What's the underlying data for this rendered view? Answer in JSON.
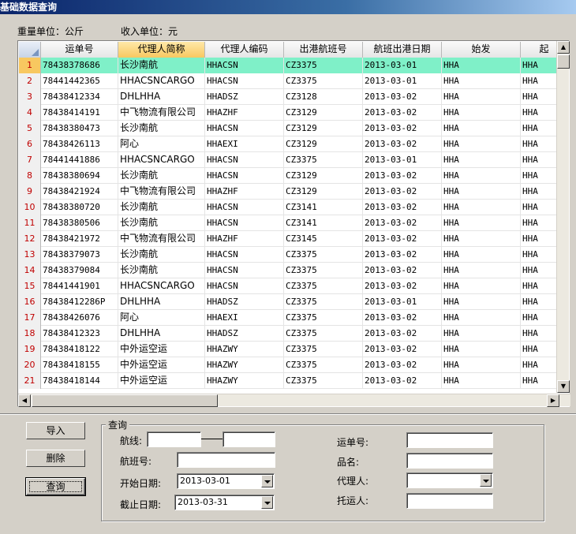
{
  "window": {
    "title": "基础数据查询"
  },
  "units": {
    "weight": "重量单位：公斤",
    "income": "收入单位：元"
  },
  "grid": {
    "columns": [
      "运单号",
      "代理人简称",
      "代理人编码",
      "出港航班号",
      "航班出港日期",
      "始发",
      "起"
    ],
    "rows": [
      {
        "n": "1",
        "awb": "78438378686",
        "agent": "长沙南航",
        "code": "HHACSN",
        "flight": "CZ3375",
        "date": "2013-03-01",
        "orig": "HHA",
        "dest": "HHA"
      },
      {
        "n": "2",
        "awb": "78441442365",
        "agent": "HHACSNCARGO",
        "code": "HHACSN",
        "flight": "CZ3375",
        "date": "2013-03-01",
        "orig": "HHA",
        "dest": "HHA"
      },
      {
        "n": "3",
        "awb": "78438412334",
        "agent": "DHLHHA",
        "code": "HHADSZ",
        "flight": "CZ3128",
        "date": "2013-03-02",
        "orig": "HHA",
        "dest": "HHA"
      },
      {
        "n": "4",
        "awb": "78438414191",
        "agent": "中飞物流有限公司",
        "code": "HHAZHF",
        "flight": "CZ3129",
        "date": "2013-03-02",
        "orig": "HHA",
        "dest": "HHA"
      },
      {
        "n": "5",
        "awb": "78438380473",
        "agent": "长沙南航",
        "code": "HHACSN",
        "flight": "CZ3129",
        "date": "2013-03-02",
        "orig": "HHA",
        "dest": "HHA"
      },
      {
        "n": "6",
        "awb": "78438426113",
        "agent": "阿心",
        "code": "HHAEXI",
        "flight": "CZ3129",
        "date": "2013-03-02",
        "orig": "HHA",
        "dest": "HHA"
      },
      {
        "n": "7",
        "awb": "78441441886",
        "agent": "HHACSNCARGO",
        "code": "HHACSN",
        "flight": "CZ3375",
        "date": "2013-03-01",
        "orig": "HHA",
        "dest": "HHA"
      },
      {
        "n": "8",
        "awb": "78438380694",
        "agent": "长沙南航",
        "code": "HHACSN",
        "flight": "CZ3129",
        "date": "2013-03-02",
        "orig": "HHA",
        "dest": "HHA"
      },
      {
        "n": "9",
        "awb": "78438421924",
        "agent": "中飞物流有限公司",
        "code": "HHAZHF",
        "flight": "CZ3129",
        "date": "2013-03-02",
        "orig": "HHA",
        "dest": "HHA"
      },
      {
        "n": "10",
        "awb": "78438380720",
        "agent": "长沙南航",
        "code": "HHACSN",
        "flight": "CZ3141",
        "date": "2013-03-02",
        "orig": "HHA",
        "dest": "HHA"
      },
      {
        "n": "11",
        "awb": "78438380506",
        "agent": "长沙南航",
        "code": "HHACSN",
        "flight": "CZ3141",
        "date": "2013-03-02",
        "orig": "HHA",
        "dest": "HHA"
      },
      {
        "n": "12",
        "awb": "78438421972",
        "agent": "中飞物流有限公司",
        "code": "HHAZHF",
        "flight": "CZ3145",
        "date": "2013-03-02",
        "orig": "HHA",
        "dest": "HHA"
      },
      {
        "n": "13",
        "awb": "78438379073",
        "agent": "长沙南航",
        "code": "HHACSN",
        "flight": "CZ3375",
        "date": "2013-03-02",
        "orig": "HHA",
        "dest": "HHA"
      },
      {
        "n": "14",
        "awb": "78438379084",
        "agent": "长沙南航",
        "code": "HHACSN",
        "flight": "CZ3375",
        "date": "2013-03-02",
        "orig": "HHA",
        "dest": "HHA"
      },
      {
        "n": "15",
        "awb": "78441441901",
        "agent": "HHACSNCARGO",
        "code": "HHACSN",
        "flight": "CZ3375",
        "date": "2013-03-02",
        "orig": "HHA",
        "dest": "HHA"
      },
      {
        "n": "16",
        "awb": "78438412286P",
        "agent": "DHLHHA",
        "code": "HHADSZ",
        "flight": "CZ3375",
        "date": "2013-03-01",
        "orig": "HHA",
        "dest": "HHA"
      },
      {
        "n": "17",
        "awb": "78438426076",
        "agent": "阿心",
        "code": "HHAEXI",
        "flight": "CZ3375",
        "date": "2013-03-02",
        "orig": "HHA",
        "dest": "HHA"
      },
      {
        "n": "18",
        "awb": "78438412323",
        "agent": "DHLHHA",
        "code": "HHADSZ",
        "flight": "CZ3375",
        "date": "2013-03-02",
        "orig": "HHA",
        "dest": "HHA"
      },
      {
        "n": "19",
        "awb": "78438418122",
        "agent": "中外运空运",
        "code": "HHAZWY",
        "flight": "CZ3375",
        "date": "2013-03-02",
        "orig": "HHA",
        "dest": "HHA"
      },
      {
        "n": "20",
        "awb": "78438418155",
        "agent": "中外运空运",
        "code": "HHAZWY",
        "flight": "CZ3375",
        "date": "2013-03-02",
        "orig": "HHA",
        "dest": "HHA"
      },
      {
        "n": "21",
        "awb": "78438418144",
        "agent": "中外运空运",
        "code": "HHAZWY",
        "flight": "CZ3375",
        "date": "2013-03-02",
        "orig": "HHA",
        "dest": "HHA"
      }
    ]
  },
  "buttons": {
    "import": "导入",
    "delete": "删除",
    "query": "查询"
  },
  "query": {
    "title": "查询",
    "route_label": "航线:",
    "flight_label": "航班号:",
    "start_label": "开始日期:",
    "start_value": "2013-03-01",
    "end_label": "截止日期:",
    "end_value": "2013-03-31",
    "awb_label": "运单号:",
    "product_label": "品名:",
    "agent_label": "代理人:",
    "shipper_label": "托运人:"
  }
}
